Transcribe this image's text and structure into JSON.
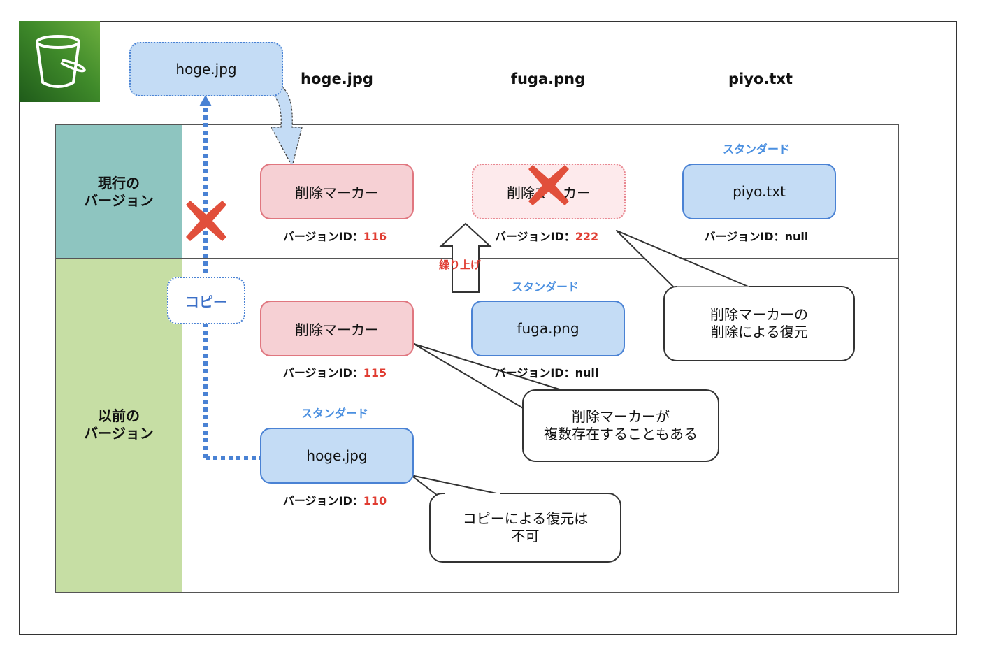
{
  "column_headers": [
    "hoge.jpg",
    "fuga.png",
    "piyo.txt"
  ],
  "row_labels": {
    "current": "現行の\nバージョン",
    "previous": "以前の\nバージョン"
  },
  "copy_source": "hoge.jpg",
  "copy_label": "コピー",
  "carry_up_label": "繰り上げ",
  "version_id_prefix": "バージョンID：",
  "current": {
    "hoge_box": "削除マーカー",
    "hoge_version": "116",
    "fuga_box": "削除マーカー",
    "fuga_version": "222",
    "piyo_class": "スタンダード",
    "piyo_box": "piyo.txt",
    "piyo_version": "null"
  },
  "previous": {
    "hoge_marker_box": "削除マーカー",
    "hoge_marker_version": "115",
    "hoge_std_class": "スタンダード",
    "hoge_std_box": "hoge.jpg",
    "hoge_std_version": "110",
    "fuga_class": "スタンダード",
    "fuga_box": "fuga.png",
    "fuga_version": "null"
  },
  "callouts": {
    "marker_delete_restore": "削除マーカーの\n削除による復元",
    "multiple_markers": "削除マーカーが\n複数存在することもある",
    "copy_restore": "コピーによる復元は\n不可"
  },
  "colors": {
    "marker_fill": "#f6d0d4",
    "object_fill": "#c4dcf5",
    "accent_red": "#e03c31",
    "accent_blue": "#4a82d4",
    "current_band": "#8ec5c0",
    "previous_band": "#c6dea4"
  },
  "icons": {
    "bucket": "s3-bucket-icon",
    "forbidden": "red-x-icon"
  }
}
